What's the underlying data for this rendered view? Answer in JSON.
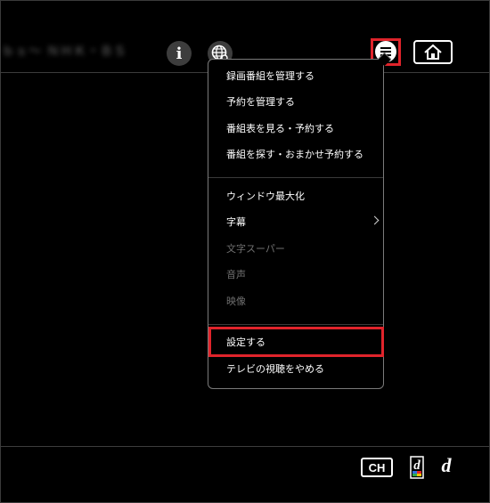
{
  "header": {
    "channel_title": "ｂｓ〜 ＮＨＫ・ＢＳ",
    "info_label": "i"
  },
  "menu": {
    "items": [
      {
        "label": "録画番組を管理する",
        "enabled": true
      },
      {
        "label": "予約を管理する",
        "enabled": true
      },
      {
        "label": "番組表を見る・予約する",
        "enabled": true
      },
      {
        "label": "番組を探す・おまかせ予約する",
        "enabled": true
      },
      {
        "label": "ウィンドウ最大化",
        "enabled": true
      },
      {
        "label": "字幕",
        "enabled": true
      },
      {
        "label": "文字スーパー",
        "enabled": false
      },
      {
        "label": "音声",
        "enabled": false
      },
      {
        "label": "映像",
        "enabled": false
      },
      {
        "label": "設定する",
        "enabled": true,
        "highlighted": true
      },
      {
        "label": "テレビの視聴をやめる",
        "enabled": true
      }
    ]
  },
  "footer": {
    "ch_label": "CH",
    "d_label": "d"
  },
  "colors": {
    "highlight": "#e0242b",
    "background": "#000000",
    "disabled_text": "#6f6f6f"
  }
}
